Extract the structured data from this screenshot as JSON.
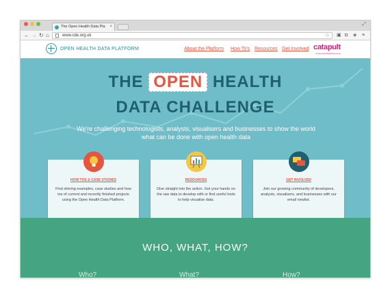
{
  "browser": {
    "tab_title": "The Open Health Data Pla",
    "url": "www.cde.org.uk"
  },
  "site": {
    "logo_text": "OPEN HEALTH DATA PLATFORM",
    "nav": [
      "About the Platform",
      "How To's",
      "Resources",
      "Get Involved"
    ],
    "sponsor": "catapult",
    "sponsor_sub": "Connected Digital Economy"
  },
  "hero": {
    "title_pre": "THE",
    "title_highlight": "OPEN",
    "title_post": "HEALTH",
    "title_line2": "DATA CHALLENGE",
    "subtitle": "We're challenging technologists, analysts, visualisers and businesses to show the world what can be done with open health data"
  },
  "cards": [
    {
      "icon": "lightbulb-icon",
      "title": "HOW TOS & CASE STUDIES",
      "body": "Find shining examples, case studies and how tos of current and recently finished projects using the Open Health Data Platform."
    },
    {
      "icon": "chart-board-icon",
      "title": "RESOURCES",
      "body": "Dive straight into the action. Get your hands on the raw data to develop with or find useful tools to help visualise data."
    },
    {
      "icon": "chat-bubbles-icon",
      "title": "GET INVOLVED",
      "body": "Join our growing community of developers, analysts, visualisers, and businesses with our email newlist."
    }
  ],
  "who": {
    "title": "WHO, WHAT, HOW?",
    "columns": [
      "Who?",
      "What?",
      "How?"
    ]
  },
  "colors": {
    "hero_bg": "#6fbdc9",
    "accent": "#e8553f",
    "title": "#1f5f6e",
    "green": "#45a582",
    "brand_pink": "#d0207c"
  }
}
